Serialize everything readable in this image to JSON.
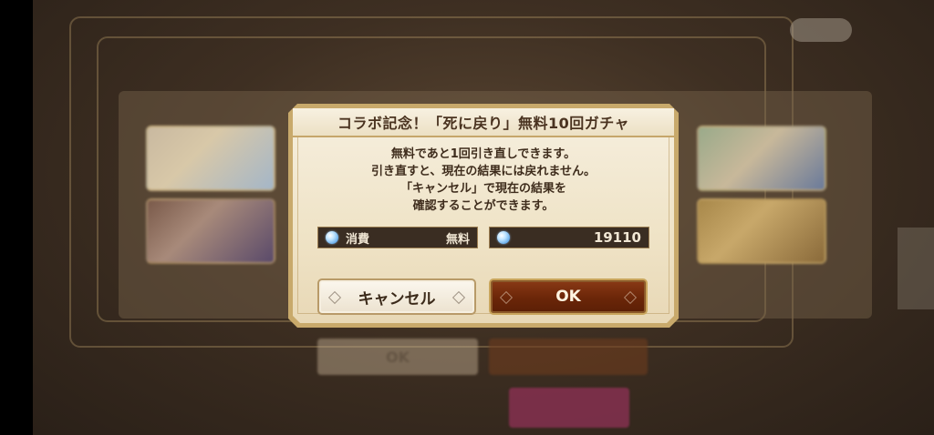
{
  "dialog": {
    "title": "コラボ記念！「死に戻り」無料10回ガチャ",
    "message_lines": [
      "無料であと1回引き直しできます。",
      "引き直すと、現在の結果には戻れません。",
      "「キャンセル」で現在の結果を",
      "確認することができます。"
    ],
    "cost": {
      "icon": "gem-icon",
      "label": "消費",
      "value": "無料"
    },
    "balance": {
      "icon": "gem-icon",
      "value": "19110"
    },
    "buttons": {
      "cancel_label": "キャンセル",
      "ok_label": "OK"
    }
  },
  "background": {
    "ok_label": "OK"
  },
  "colors": {
    "ok_button": "#6b2608",
    "dialog_border": "#c8a96b",
    "cost_box": "#3a2d22",
    "gem": "#5aa4e8"
  }
}
